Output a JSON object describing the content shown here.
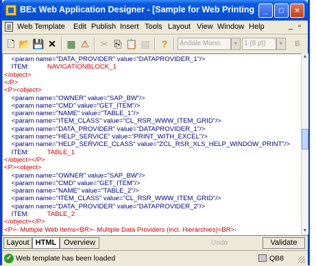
{
  "window": {
    "title": "BEx Web Application Designer - [Sample for Web Printing with Excel]"
  },
  "menu": [
    "Web Template",
    "Edit",
    "Publish",
    "Insert",
    "Tools",
    "Layout",
    "View",
    "Window",
    "Help"
  ],
  "toolbar": {
    "font_name": "Andale Mono",
    "font_size": "1 (8 pt)",
    "extra": "B"
  },
  "editor_lines": [
    [
      {
        "c": "attr",
        "t": "    <param name=\"DATA_PROVIDER\" value=\"DATAPROVIDER_1\"/>"
      }
    ],
    [
      {
        "c": "attr",
        "t": "    ITEM:"
      },
      {
        "c": "red",
        "t": "          NAVIGATIONBLOCK_1"
      }
    ],
    [
      {
        "c": "tag",
        "t": "</object>"
      }
    ],
    [
      {
        "c": "tag",
        "t": "</P>"
      }
    ],
    [
      {
        "c": "tag",
        "t": "<P><object>"
      }
    ],
    [
      {
        "c": "attr",
        "t": "    <param name=\"OWNER\" value=\"SAP_BW\"/>"
      }
    ],
    [
      {
        "c": "attr",
        "t": "    <param name=\"CMD\" value=\"GET_ITEM\"/>"
      }
    ],
    [
      {
        "c": "attr",
        "t": "    <param name=\"NAME\" value=\"TABLE_1\"/>"
      }
    ],
    [
      {
        "c": "attr",
        "t": "    <param name=\"ITEM_CLASS\" value=\"CL_RSR_WWW_ITEM_GRID\"/>"
      }
    ],
    [
      {
        "c": "attr",
        "t": "    <param name=\"DATA_PROVIDER\" value=\"DATAPROVIDER_1\"/>"
      }
    ],
    [
      {
        "c": "attr",
        "t": "    <param name=\"HELP_SERVICE\" value=\"PRINT_WITH_EXCEL\"/>"
      }
    ],
    [
      {
        "c": "attr",
        "t": "    <param name=\"HELP_SERVICE_CLASS\" value=\"ZCL_RSR_XLS_HELP_WINDOW_PRINT\"/>"
      }
    ],
    [
      {
        "c": "attr",
        "t": "    ITEM:"
      },
      {
        "c": "red",
        "t": "          TABLE_1"
      }
    ],
    [
      {
        "c": "tag",
        "t": "</object></P>"
      }
    ],
    [
      {
        "c": "tag",
        "t": "<P><object>"
      }
    ],
    [
      {
        "c": "attr",
        "t": "    <param name=\"OWNER\" value=\"SAP_BW\"/>"
      }
    ],
    [
      {
        "c": "attr",
        "t": "    <param name=\"CMD\" value=\"GET_ITEM\"/>"
      }
    ],
    [
      {
        "c": "attr",
        "t": "    <param name=\"NAME\" value=\"TABLE_2\"/>"
      }
    ],
    [
      {
        "c": "attr",
        "t": "    <param name=\"ITEM_CLASS\" value=\"CL_RSR_WWW_ITEM_GRID\"/>"
      }
    ],
    [
      {
        "c": "attr",
        "t": "    <param name=\"DATA_PROVIDER\" value=\"DATAPROVIDER_2\"/>"
      }
    ],
    [
      {
        "c": "attr",
        "t": "    ITEM:"
      },
      {
        "c": "red",
        "t": "          TABLE_2"
      }
    ],
    [
      {
        "c": "tag",
        "t": "</object></P>"
      }
    ],
    [
      {
        "c": "tag",
        "t": "<P>- Multiple Web Items<BR>- Multiple Data Providers (incl. Hierarchies)<BR>-"
      }
    ]
  ],
  "tabs": {
    "layout": "Layout",
    "html": "HTML",
    "overview": "Overview",
    "undo": "Undo",
    "validate": "Validate"
  },
  "status": {
    "message": "Web template has been loaded",
    "system": "QB8"
  }
}
